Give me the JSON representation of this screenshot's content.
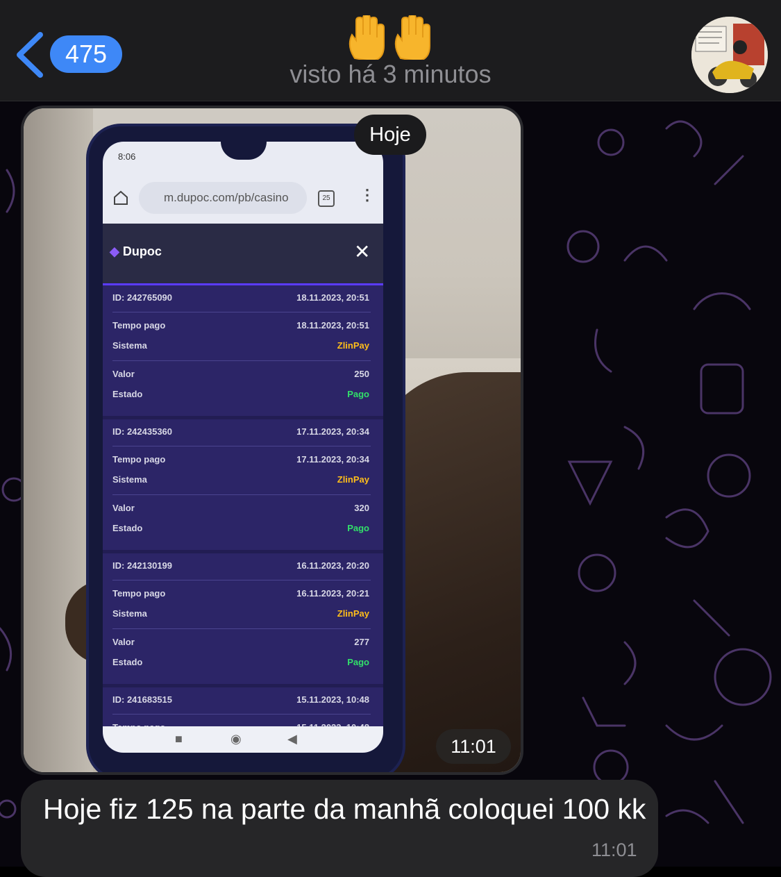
{
  "header": {
    "back_count": "475",
    "title_emoji": "🖐🖐",
    "subtitle": "visto há 3 minutos",
    "avatar_alt": "contact-avatar"
  },
  "messages": [
    {
      "type": "photo",
      "date_badge": "Hoje",
      "time": "11:01",
      "photo": {
        "status_time": "8:06",
        "url": "m.dupoc.com/pb/casino",
        "tab_count": "25",
        "app_name": "Dupoc",
        "labels": {
          "paid_time": "Tempo pago",
          "system": "Sistema",
          "value": "Valor",
          "state": "Estado"
        },
        "records": [
          {
            "id": "ID: 242765090",
            "created": "18.11.2023, 20:51",
            "paid": "18.11.2023, 20:51",
            "system": "ZlinPay",
            "value": "250",
            "state": "Pago"
          },
          {
            "id": "ID: 242435360",
            "created": "17.11.2023, 20:34",
            "paid": "17.11.2023, 20:34",
            "system": "ZlinPay",
            "value": "320",
            "state": "Pago"
          },
          {
            "id": "ID: 242130199",
            "created": "16.11.2023, 20:20",
            "paid": "16.11.2023, 20:21",
            "system": "ZlinPay",
            "value": "277",
            "state": "Pago"
          },
          {
            "id": "ID: 241683515",
            "created": "15.11.2023, 10:48",
            "paid": "15.11.2023, 10:48",
            "system": "",
            "value": "",
            "state": ""
          }
        ]
      }
    },
    {
      "type": "text",
      "text": "Hoje fiz 125 na parte da manhã coloquei 100 kk",
      "time": "11:01"
    }
  ]
}
